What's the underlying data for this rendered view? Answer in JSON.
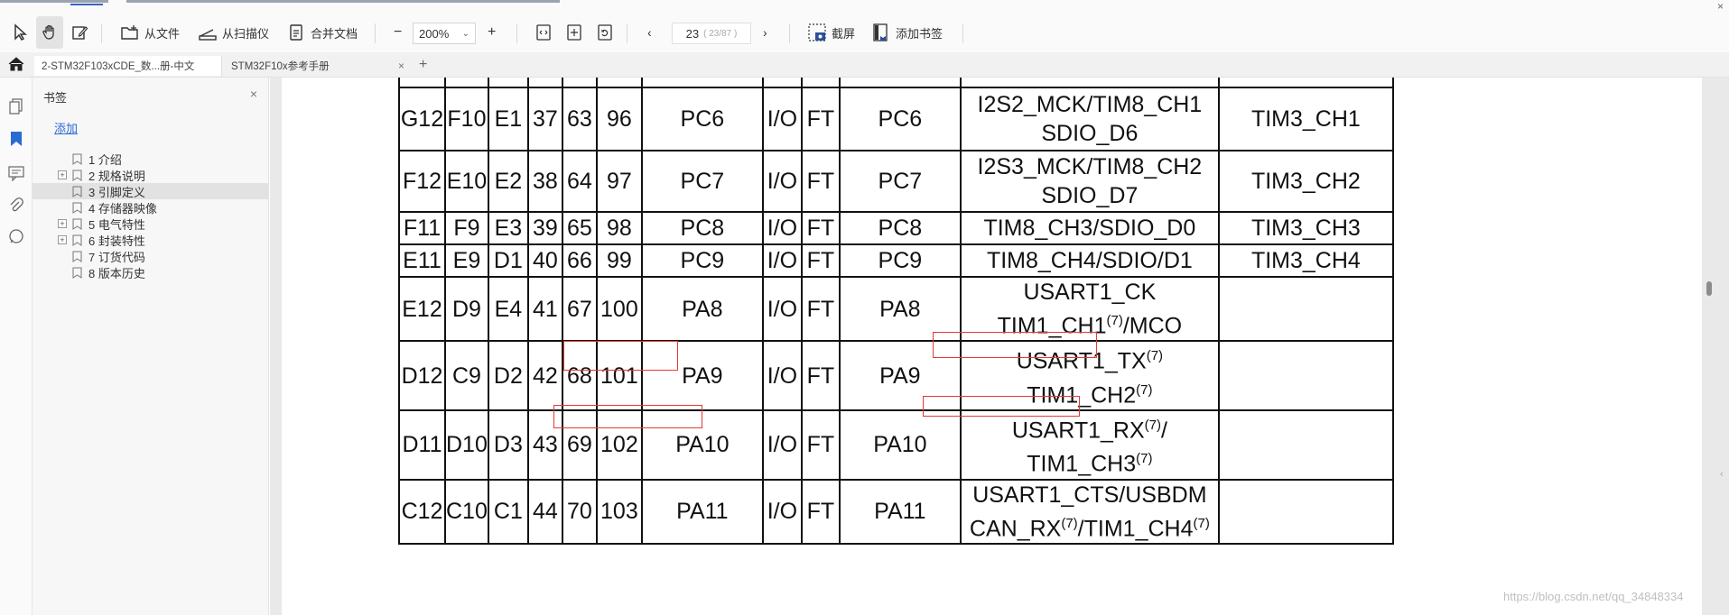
{
  "toolbar": {
    "tools": [
      {
        "name": "select-tool",
        "label": ""
      },
      {
        "name": "hand-tool",
        "label": ""
      },
      {
        "name": "edit-tool",
        "label": ""
      }
    ],
    "from_file": "从文件",
    "from_scanner": "从扫描仪",
    "merge_docs": "合并文档",
    "zoom_minus": "−",
    "zoom_value": "200%",
    "zoom_plus": "+",
    "page_current": "23",
    "page_total": "( 23/87 )",
    "screenshot": "截屏",
    "add_bookmark": "添加书签"
  },
  "tabs": [
    {
      "label": "2-STM32F103xCDE_数...册-中文",
      "active": true
    },
    {
      "label": "STM32F10x参考手册",
      "active": false
    }
  ],
  "panel": {
    "title": "书签",
    "add_label": "添加",
    "items": [
      {
        "label": "1 介绍",
        "expandable": false,
        "selected": false
      },
      {
        "label": "2 规格说明",
        "expandable": true,
        "selected": false
      },
      {
        "label": "3 引脚定义",
        "expandable": false,
        "selected": true
      },
      {
        "label": "4 存储器映像",
        "expandable": false,
        "selected": false
      },
      {
        "label": "5 电气特性",
        "expandable": true,
        "selected": false
      },
      {
        "label": "6 封装特性",
        "expandable": true,
        "selected": false
      },
      {
        "label": "7 订货代码",
        "expandable": false,
        "selected": false
      },
      {
        "label": "8 版本历史",
        "expandable": false,
        "selected": false
      }
    ]
  },
  "pin_table": {
    "rows": [
      {
        "c": [
          "G12",
          "F10",
          "E1",
          "37",
          "63",
          "96",
          "PC6",
          "I/O",
          "FT",
          "PC6"
        ],
        "alt1": "I2S2_MCK/TIM8_CH1",
        "alt2": "SDIO_D6",
        "remap": "TIM3_CH1"
      },
      {
        "c": [
          "F12",
          "E10",
          "E2",
          "38",
          "64",
          "97",
          "PC7",
          "I/O",
          "FT",
          "PC7"
        ],
        "alt1": "I2S3_MCK/TIM8_CH2",
        "alt2": "SDIO_D7",
        "remap": "TIM3_CH2"
      },
      {
        "c": [
          "F11",
          "F9",
          "E3",
          "39",
          "65",
          "98",
          "PC8",
          "I/O",
          "FT",
          "PC8"
        ],
        "alt1": "TIM8_CH3/SDIO_D0",
        "alt2": "",
        "remap": "TIM3_CH3"
      },
      {
        "c": [
          "E11",
          "E9",
          "D1",
          "40",
          "66",
          "99",
          "PC9",
          "I/O",
          "FT",
          "PC9"
        ],
        "alt1": "TIM8_CH4/SDIO/D1",
        "alt2": "",
        "remap": "TIM3_CH4"
      },
      {
        "c": [
          "E12",
          "D9",
          "E4",
          "41",
          "67",
          "100",
          "PA8",
          "I/O",
          "FT",
          "PA8"
        ],
        "alt1": "USART1_CK",
        "alt2": "TIM1_CH1",
        "alt2_sup": "(7)",
        "alt2_tail": "/MCO",
        "remap": ""
      },
      {
        "c": [
          "D12",
          "C9",
          "D2",
          "42",
          "68",
          "101",
          "PA9",
          "I/O",
          "FT",
          "PA9"
        ],
        "alt1": "USART1_TX",
        "alt1_sup": "(7)",
        "alt2": "TIM1_CH2",
        "alt2_sup": "(7)",
        "remap": ""
      },
      {
        "c": [
          "D11",
          "D10",
          "D3",
          "43",
          "69",
          "102",
          "PA10",
          "I/O",
          "FT",
          "PA10"
        ],
        "alt1": "USART1_RX",
        "alt1_sup": "(7)",
        "alt1_tail": "/",
        "alt2": "TIM1_CH3",
        "alt2_sup": "(7)",
        "remap": ""
      },
      {
        "c": [
          "C12",
          "C10",
          "C1",
          "44",
          "70",
          "103",
          "PA11",
          "I/O",
          "FT",
          "PA11"
        ],
        "alt1": "USART1_CTS/USBDM",
        "alt2": "CAN_RX",
        "alt2_sup": "(7)",
        "alt2_tail": "/TIM1_CH4",
        "alt2_tail_sup": "(7)",
        "remap": ""
      }
    ]
  },
  "watermark": "https://blog.csdn.net/qq_34848334",
  "colors": {
    "highlight": "#e53935",
    "link": "#2a6bd1"
  }
}
